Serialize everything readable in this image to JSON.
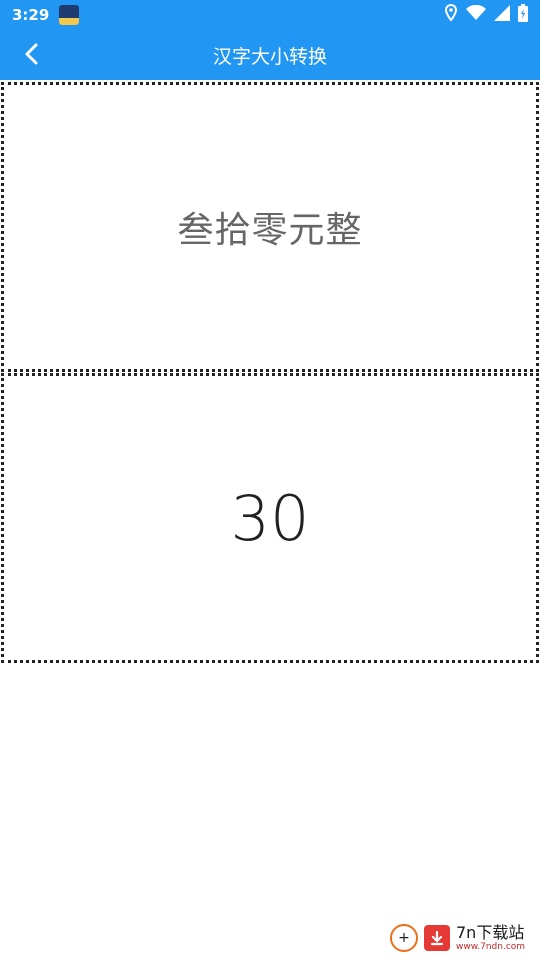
{
  "status_bar": {
    "time": "3:29",
    "icons": [
      "location-icon",
      "wifi-icon",
      "signal-icon",
      "battery-charging-icon"
    ]
  },
  "app_bar": {
    "title": "汉字大小转换",
    "back_icon": "chevron-left-icon"
  },
  "result": {
    "chinese_uppercase": "叁拾零元整",
    "number": "30"
  },
  "watermark": {
    "main": "7n下载站",
    "sub": "www.7ndn.com"
  },
  "colors": {
    "primary": "#2196F3",
    "text_gray": "#666666",
    "text_dark": "#222222",
    "watermark_red": "#e53935"
  }
}
